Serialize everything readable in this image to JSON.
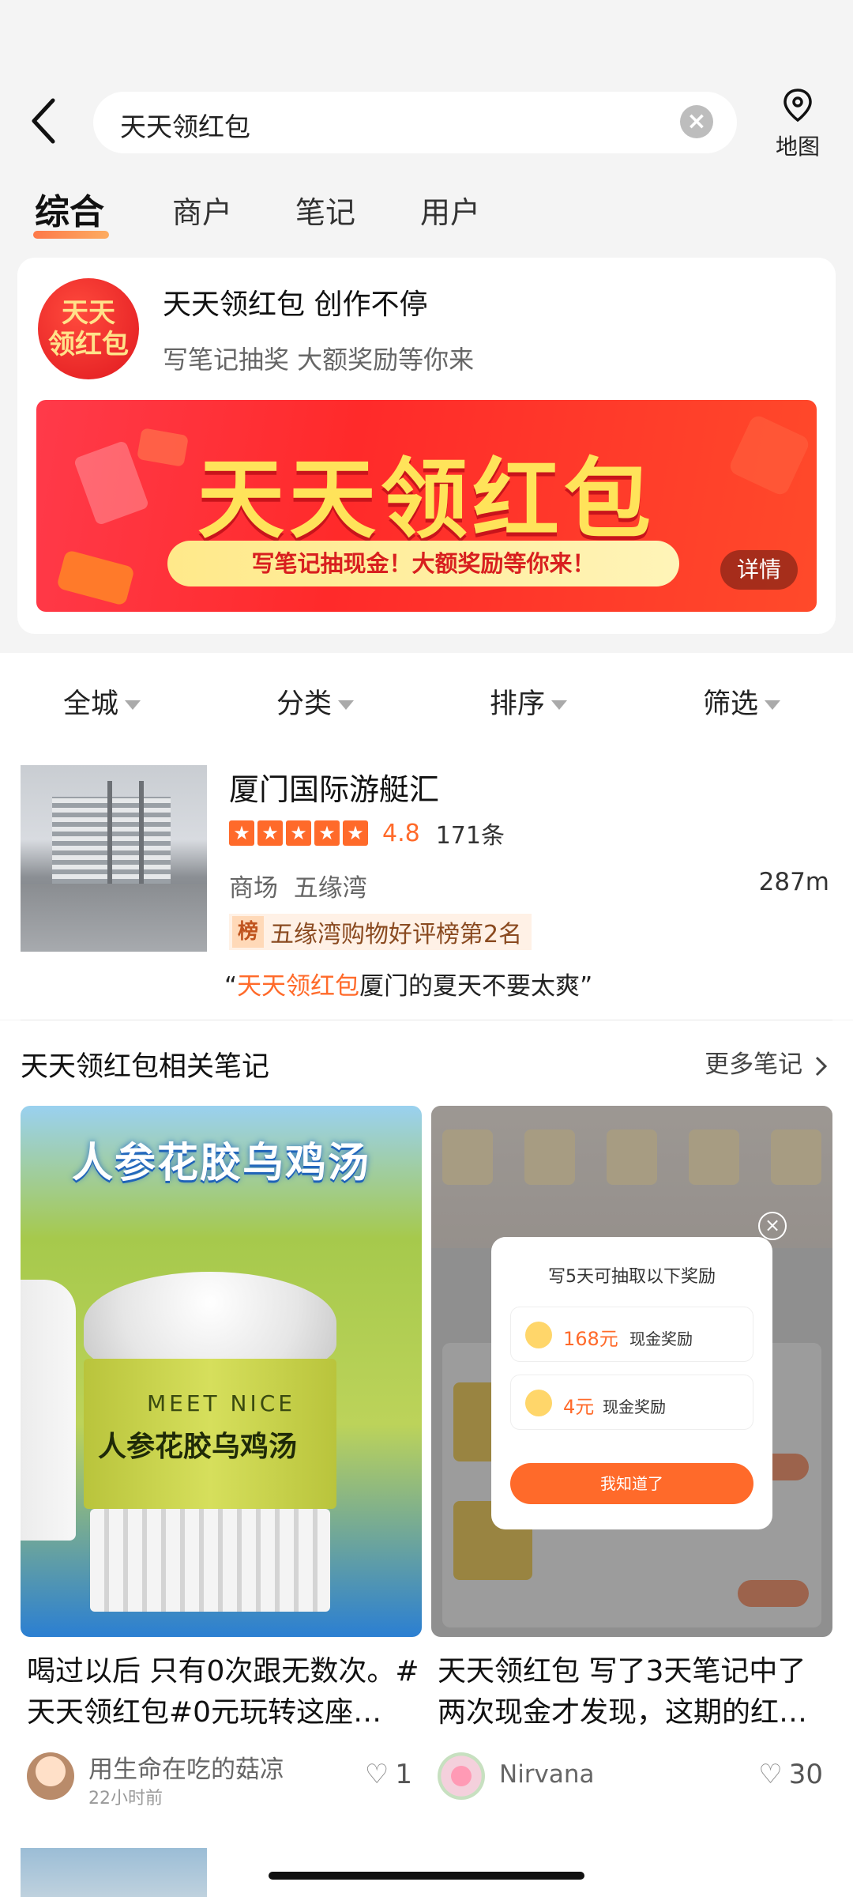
{
  "search": {
    "query": "天天领红包",
    "map_label": "地图"
  },
  "tabs": [
    {
      "label": "综合",
      "active": true
    },
    {
      "label": "商户"
    },
    {
      "label": "笔记"
    },
    {
      "label": "用户"
    }
  ],
  "promo": {
    "logo_line1": "天天",
    "logo_line2": "领红包",
    "title": "天天领红包 创作不停",
    "subtitle": "写笔记抽奖 大额奖励等你来",
    "banner_title": "天天领红包",
    "banner_slogan": "写笔记抽现金！大额奖励等你来！",
    "banner_detail": "详情"
  },
  "filters": [
    "全城",
    "分类",
    "排序",
    "筛选"
  ],
  "merchant": {
    "name": "厦门国际游艇汇",
    "rating": "4.8",
    "rating_value": 4.8,
    "reviews": "171条",
    "category": "商场",
    "area": "五缘湾",
    "distance": "287m",
    "rank_icon": "榜",
    "rank_text": "五缘湾购物好评榜第2名",
    "quote_open": "“",
    "quote_highlight": "天天领红包",
    "quote_rest": "厦门的夏天不要太爽",
    "quote_close": "”"
  },
  "notes_section": {
    "title": "天天领红包相关笔记",
    "more": "更多笔记"
  },
  "notes": [
    {
      "image_headline": "人参花胶乌鸡汤",
      "jar_brand": "MEET NICE",
      "jar_product": "人参花胶乌鸡汤",
      "title": "喝过以后 只有0次跟无数次。#天天领红包#0元玩转这座…",
      "author": "用生命在吃的菇凉",
      "time": "22小时前",
      "likes": "1"
    },
    {
      "popup_title": "写5天可抽取以下奖励",
      "reward1_amount": "168元",
      "reward1_desc": "现金奖励",
      "reward2_amount": "4元",
      "reward2_desc": "现金奖励",
      "popup_button": "我知道了",
      "title": "天天领红包 写了3天笔记中了两次现金才发现，这期的红…",
      "author": "Nirvana",
      "likes": "30"
    }
  ],
  "colors": {
    "accent": "#ff6a2a",
    "banner_red": "#ff2a2a",
    "banner_yellow": "#ffe35a"
  }
}
